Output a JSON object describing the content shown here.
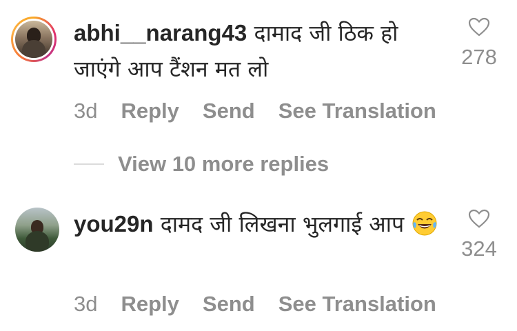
{
  "comments": [
    {
      "username": "abhi__narang43",
      "text": "दामाद जी ठिक हो जाएंगे आप टैंशन मत लो",
      "time": "3d",
      "reply_label": "Reply",
      "send_label": "Send",
      "translate_label": "See Translation",
      "likes": "278",
      "avatar_has_story_ring": true
    },
    {
      "username": "you29n",
      "text": "दामद जी लिखना भुलगाई आप",
      "emoji": "face-with-tears-of-joy",
      "time": "3d",
      "reply_label": "Reply",
      "send_label": "Send",
      "translate_label": "See Translation",
      "likes": "324",
      "avatar_has_story_ring": false
    }
  ],
  "more_replies": {
    "label": "View 10 more replies"
  },
  "colors": {
    "text": "#262626",
    "muted": "#8e8e8e",
    "divider": "#dbdbdb"
  }
}
